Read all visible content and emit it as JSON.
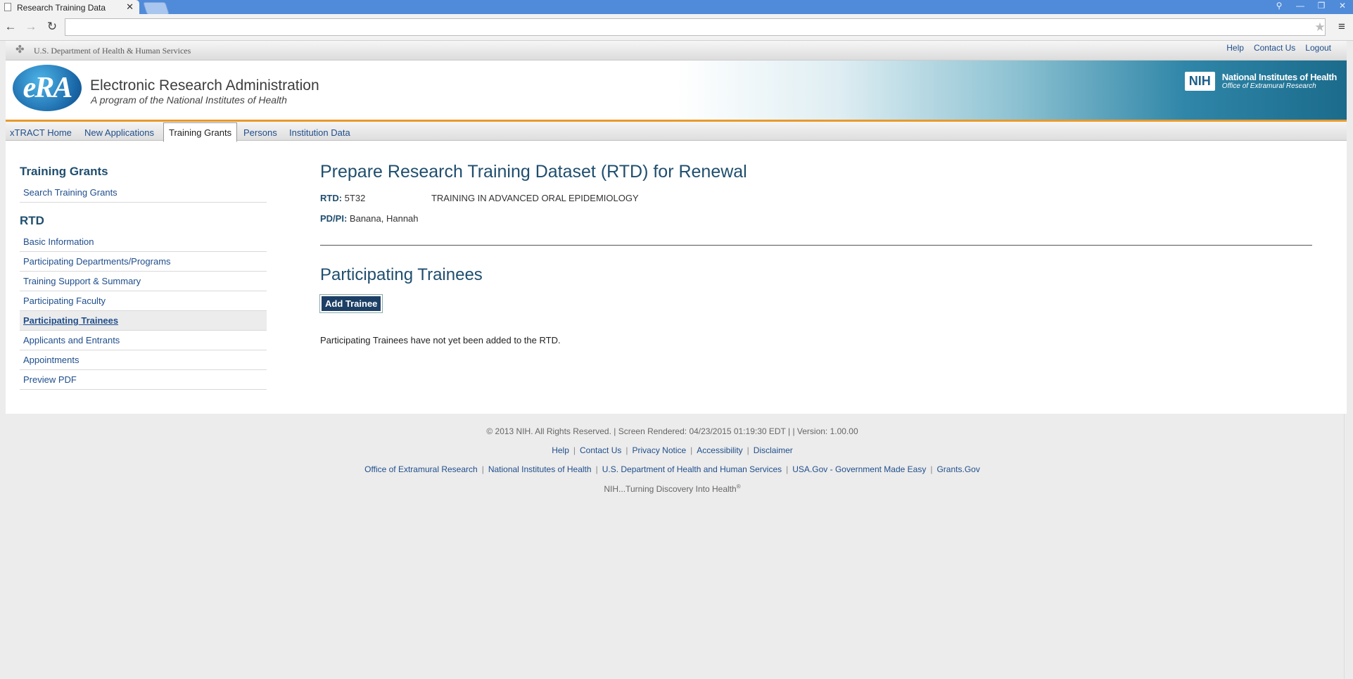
{
  "browser": {
    "tab_title": "Research Training Data",
    "address": ""
  },
  "hhs": {
    "name": "U.S. Department of Health & Human Services"
  },
  "utility_links": [
    "Help",
    "Contact Us",
    "Logout"
  ],
  "banner": {
    "logo_text": "eRA",
    "title": "Electronic Research Administration",
    "subtitle": "A program of the National Institutes of Health",
    "nih_box": "NIH",
    "nih_name": "National Institutes of Health",
    "nih_office": "Office of Extramural Research"
  },
  "main_nav": [
    {
      "label": "xTRACT Home"
    },
    {
      "label": "New Applications"
    },
    {
      "label": "Training Grants",
      "active": true
    },
    {
      "label": "Persons"
    },
    {
      "label": "Institution Data"
    }
  ],
  "sidebar": {
    "heading1": "Training Grants",
    "group1": [
      "Search Training Grants"
    ],
    "heading2": "RTD",
    "group2": [
      "Basic Information",
      "Participating Departments/Programs",
      "Training Support & Summary",
      "Participating Faculty",
      "Participating Trainees",
      "Applicants and Entrants",
      "Appointments",
      "Preview PDF"
    ],
    "current": "Participating Trainees"
  },
  "content": {
    "title": "Prepare Research Training Dataset (RTD) for Renewal",
    "rtd_label": "RTD:",
    "rtd_value": "5T32",
    "rtd_title": "TRAINING IN ADVANCED ORAL EPIDEMIOLOGY",
    "pi_label": "PD/PI:",
    "pi_value": "Banana, Hannah",
    "section_title": "Participating Trainees",
    "add_button": "Add Trainee",
    "empty_message": "Participating Trainees have not yet been added to the RTD."
  },
  "footer": {
    "copyright": "© 2013 NIH. All Rights Reserved. | Screen Rendered: 04/23/2015 01:19:30 EDT | | Version: 1.00.00",
    "links1": [
      "Help",
      "Contact Us",
      "Privacy Notice",
      "Accessibility",
      "Disclaimer"
    ],
    "links2": [
      "Office of Extramural Research",
      "National Institutes of Health",
      "U.S. Department of Health and Human Services",
      "USA.Gov - Government Made Easy",
      "Grants.Gov"
    ],
    "tagline": "NIH...Turning Discovery Into Health",
    "tagline_mark": "®"
  }
}
